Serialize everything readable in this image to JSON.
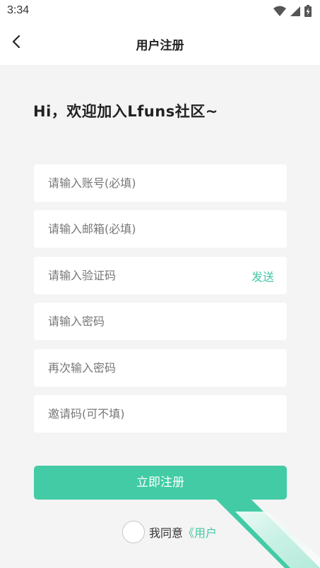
{
  "status_bar": {
    "time": "3:34"
  },
  "header": {
    "title": "用户注册"
  },
  "welcome": {
    "text": "Hi，欢迎加入Lfuns社区~"
  },
  "form": {
    "account_placeholder": "请输入账号(必填)",
    "email_placeholder": "请输入邮箱(必填)",
    "code_placeholder": "请输入验证码",
    "send_label": "发送",
    "password_placeholder": "请输入密码",
    "confirm_password_placeholder": "再次输入密码",
    "invite_placeholder": "邀请码(可不填)"
  },
  "register_button": {
    "label": "立即注册"
  },
  "agreement": {
    "prefix": "我同意",
    "link": "《用户"
  },
  "colors": {
    "accent": "#42cba5",
    "background": "#f4f4f4"
  }
}
